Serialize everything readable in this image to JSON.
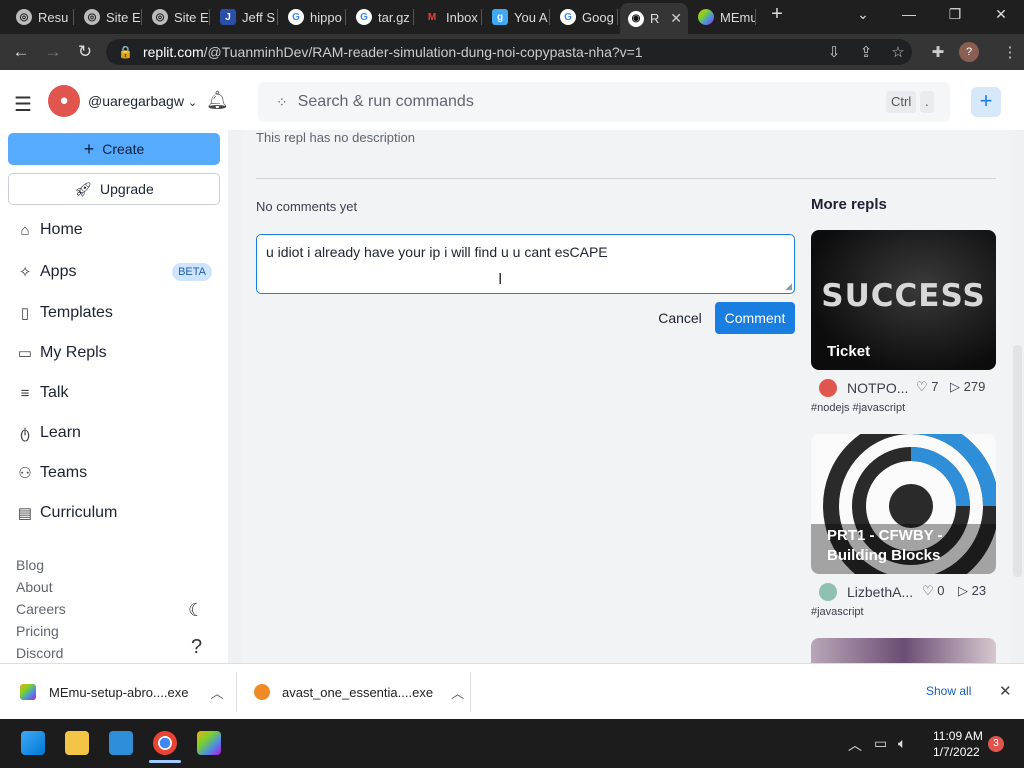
{
  "browser": {
    "tabs": [
      {
        "label": "Resu",
        "icon": "globe-icon"
      },
      {
        "label": "Site E",
        "icon": "globe-icon"
      },
      {
        "label": "Site E",
        "icon": "globe-icon"
      },
      {
        "label": "Jeff S",
        "icon": "j-logo-icon"
      },
      {
        "label": "hippo",
        "icon": "google-icon"
      },
      {
        "label": "tar.gz",
        "icon": "google-icon"
      },
      {
        "label": "Inbox",
        "icon": "gmail-icon"
      },
      {
        "label": "You A",
        "icon": "g-logo-icon"
      },
      {
        "label": "Goog",
        "icon": "google-icon"
      },
      {
        "label": "R",
        "icon": "replit-icon",
        "active": true
      },
      {
        "label": "MEmu",
        "icon": "memu-icon"
      }
    ],
    "url_host": "replit.com",
    "url_path": "/@TuanminhDev/RAM-reader-simulation-dung-noi-copypasta-nha?v=1",
    "profile_initial": "?"
  },
  "sidebar": {
    "username": "@uaregarbagw",
    "create_label": "Create",
    "upgrade_label": "Upgrade",
    "nav": [
      {
        "label": "Home",
        "icon": "home-icon"
      },
      {
        "label": "Apps",
        "icon": "sparkle-icon",
        "badge": "BETA"
      },
      {
        "label": "Templates",
        "icon": "file-icon"
      },
      {
        "label": "My Repls",
        "icon": "folder-icon"
      },
      {
        "label": "Talk",
        "icon": "list-icon"
      },
      {
        "label": "Learn",
        "icon": "apple-icon"
      },
      {
        "label": "Teams",
        "icon": "people-icon"
      },
      {
        "label": "Curriculum",
        "icon": "book-icon"
      }
    ],
    "footer_links": [
      "Blog",
      "About",
      "Careers",
      "Pricing",
      "Discord"
    ]
  },
  "search": {
    "placeholder": "Search & run commands",
    "kbd1": "Ctrl",
    "kbd2": "."
  },
  "main": {
    "description": "This repl has no description",
    "comments_status": "No comments yet",
    "comment_text": "u idiot i already have your ip i will find u u cant esCAPE",
    "cancel_label": "Cancel",
    "comment_label": "Comment",
    "more_repls_title": "More repls",
    "repls": [
      {
        "title": "Ticket",
        "banner": "SUCCESS",
        "author": "NOTPO...",
        "likes": "7",
        "runs": "279",
        "tags": "#nodejs #javascript"
      },
      {
        "title": "PRT1 - CFWBY - Building Blocks",
        "author": "LizbethA...",
        "likes": "0",
        "runs": "23",
        "tags": "#javascript"
      }
    ]
  },
  "downloads": {
    "items": [
      {
        "name": "MEmu-setup-abro....exe"
      },
      {
        "name": "avast_one_essentia....exe"
      }
    ],
    "show_all": "Show all"
  },
  "taskbar": {
    "time": "11:09 AM",
    "date": "1/7/2022",
    "notifications": "3"
  },
  "colors": {
    "accent": "#1a7de0",
    "create_bg": "#57abff",
    "beta_bg": "#cfe5ff"
  }
}
